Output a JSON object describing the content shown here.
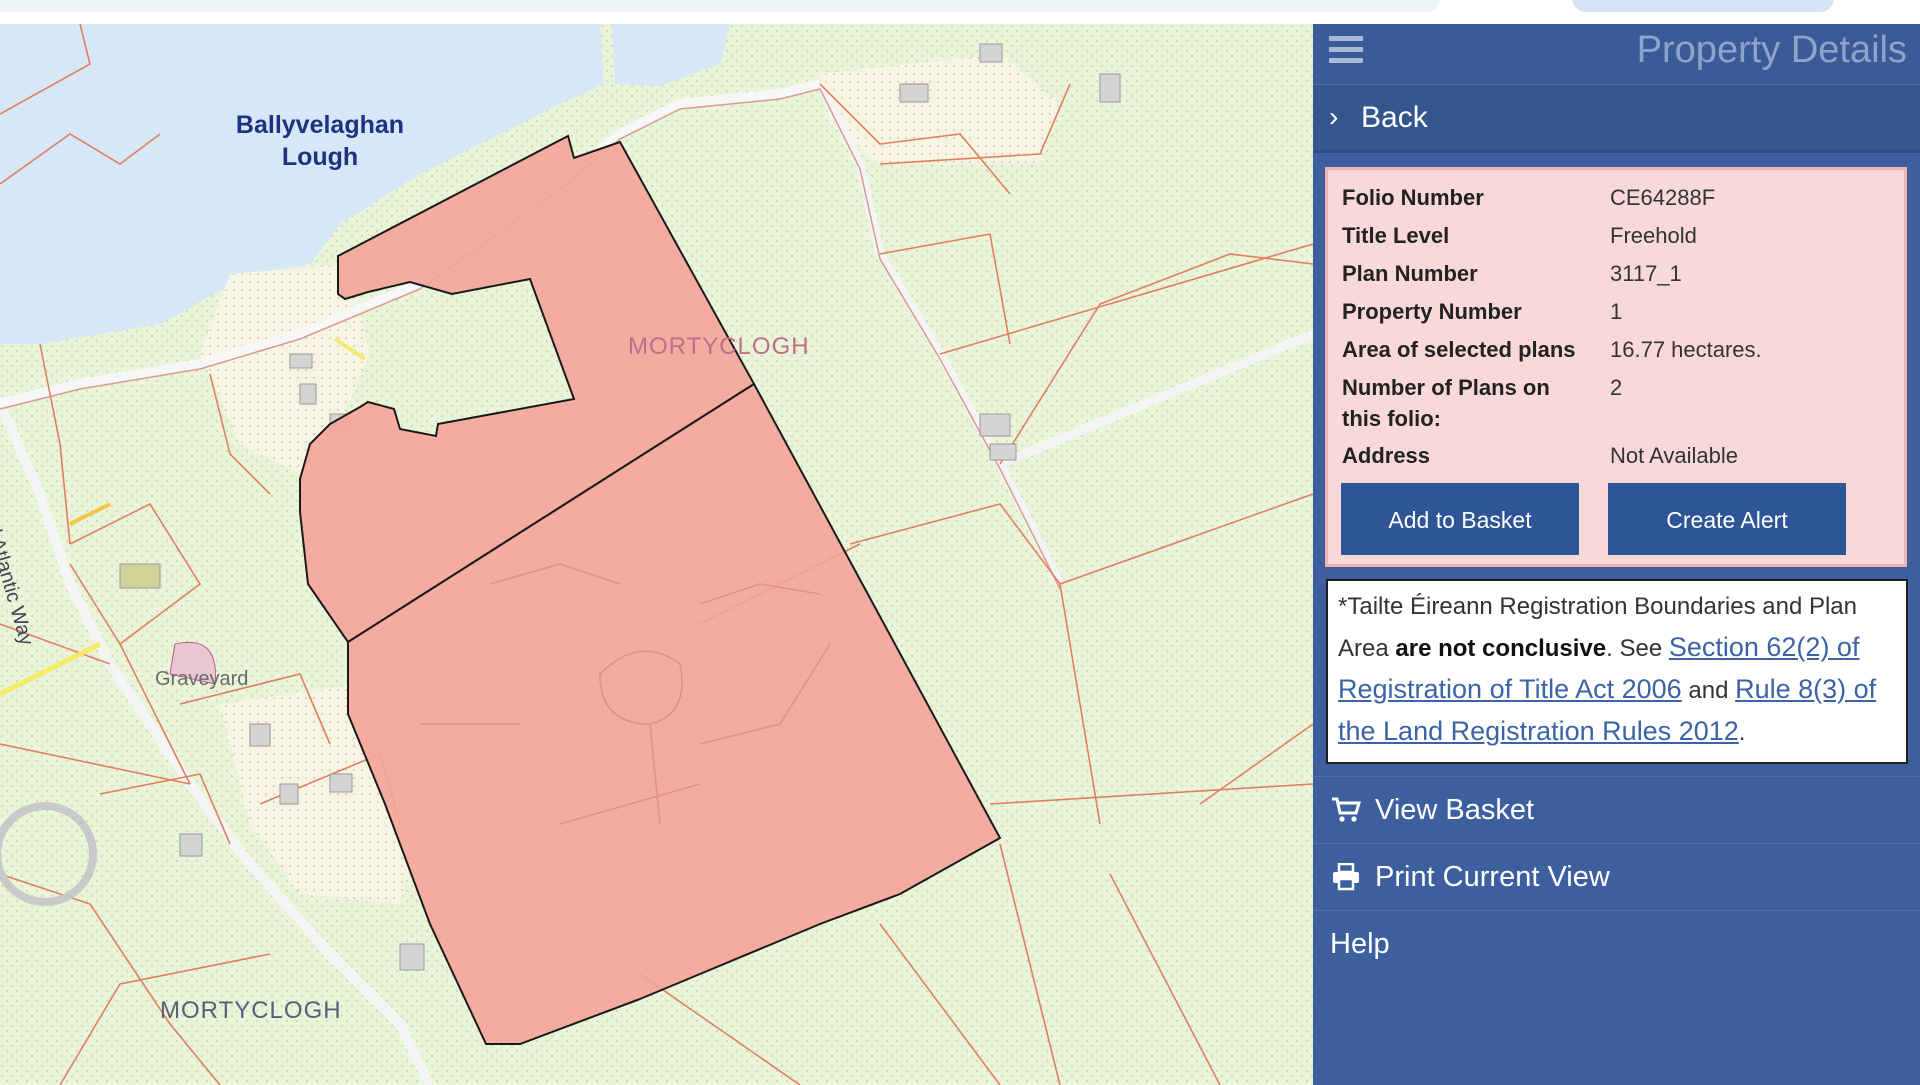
{
  "map": {
    "lake_label_line1": "Ballyvelaghan",
    "lake_label_line2": "Lough",
    "townland_label_1": "MORTYCLOGH",
    "townland_label_2": "MORTYCLOGH",
    "graveyard_label": "Graveyard",
    "road_label": "Wild Atlantic Way"
  },
  "panel": {
    "title": "Property Details",
    "back_label": "Back",
    "details": [
      {
        "key": "Folio Number",
        "value": "CE64288F"
      },
      {
        "key": "Title Level",
        "value": "Freehold"
      },
      {
        "key": "Plan Number",
        "value": "3117_1"
      },
      {
        "key": "Property Number",
        "value": "1"
      },
      {
        "key": "Area of selected plans",
        "value": "16.77 hectares."
      },
      {
        "key": "Number of Plans on this folio:",
        "value": "2"
      },
      {
        "key": "Address",
        "value": "Not Available"
      }
    ],
    "add_to_basket": "Add to Basket",
    "create_alert": "Create Alert",
    "notice": {
      "part1": "*Tailte Éireann Registration Boundaries and Plan Area ",
      "bold": "are not conclusive",
      "part2": ". See ",
      "link1": "Section 62(2) of Registration of Title Act 2006",
      "part3": " and ",
      "link2": "Rule 8(3) of the Land Registration Rules 2012",
      "part4": "."
    },
    "view_basket": "View Basket",
    "print_view": "Print Current View",
    "help": "Help"
  },
  "colors": {
    "panel_bg": "#3d5f9d",
    "card_bg": "#f8d8d8",
    "button_bg": "#2e5596",
    "parcel_fill": "#f3a59a",
    "lake": "#d6e7f7",
    "field": "#eaf4d9"
  },
  "icons": [
    "menu-icon",
    "chevron-right-icon",
    "cart-icon",
    "printer-icon"
  ]
}
